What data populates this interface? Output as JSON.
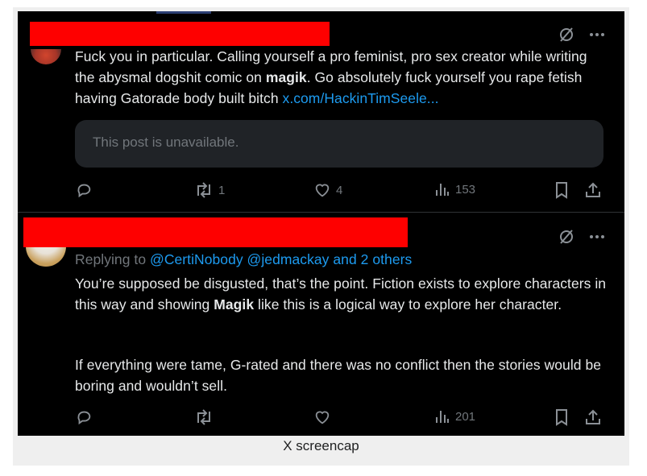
{
  "post1": {
    "text_a": "Fuck you in particular. Calling yourself a pro feminist, pro sex creator while writing the abysmal dogshit comic on ",
    "bold": "magik",
    "text_b": ". Go absolutely fuck yourself you rape fetish having Gatorade body built bitch ",
    "link": "x.com/HackinTimSeele...",
    "quote": "This post is unavailable.",
    "retweets": "1",
    "likes": "4",
    "views": "153"
  },
  "post2": {
    "replying_prefix": "Replying to ",
    "replying_to": "@CertiNobody @jedmackay and 2 others",
    "para1_a": "You’re supposed be disgusted, that’s the point. Fiction exists to explore characters in this way and showing ",
    "para1_bold": "Magik",
    "para1_b": " like this is a logical way to explore her character.",
    "para2": "If everything were tame, G-rated and there was no conflict then the stories would be boring and wouldn’t sell.",
    "views": "201"
  },
  "caption": "X screencap",
  "colors": {
    "background": "#000000",
    "text": "#e7e9ea",
    "muted": "#71767b",
    "link": "#1d9bf0",
    "redaction": "#fe0000"
  }
}
